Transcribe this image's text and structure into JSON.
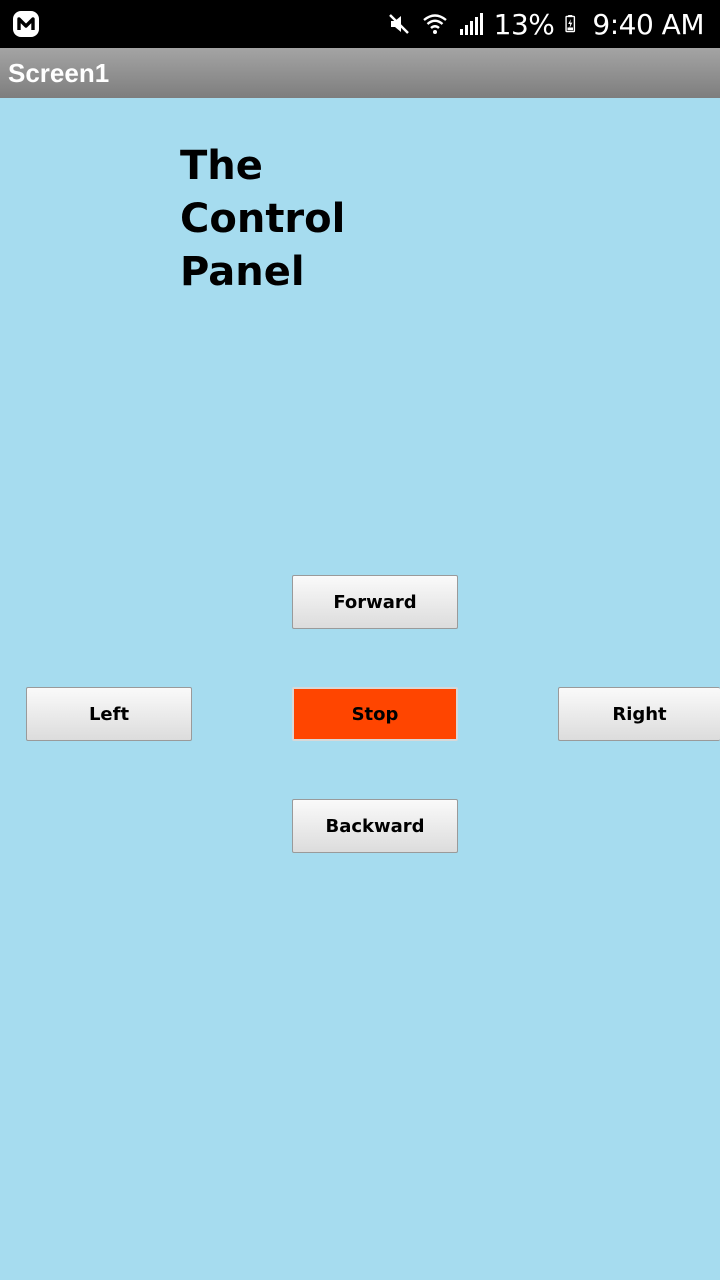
{
  "status_bar": {
    "battery": "13%",
    "time": "9:40 AM",
    "icons": [
      "app-notification-icon",
      "mute-icon",
      "wifi-icon",
      "signal-icon",
      "battery-icon"
    ]
  },
  "app_bar": {
    "title": "Screen1"
  },
  "heading": "The\nControl\nPanel",
  "controls": {
    "forward": "Forward",
    "left": "Left",
    "stop": "Stop",
    "right": "Right",
    "backward": "Backward"
  },
  "colors": {
    "background": "#a6dcef",
    "stop_button": "#ff4500"
  }
}
